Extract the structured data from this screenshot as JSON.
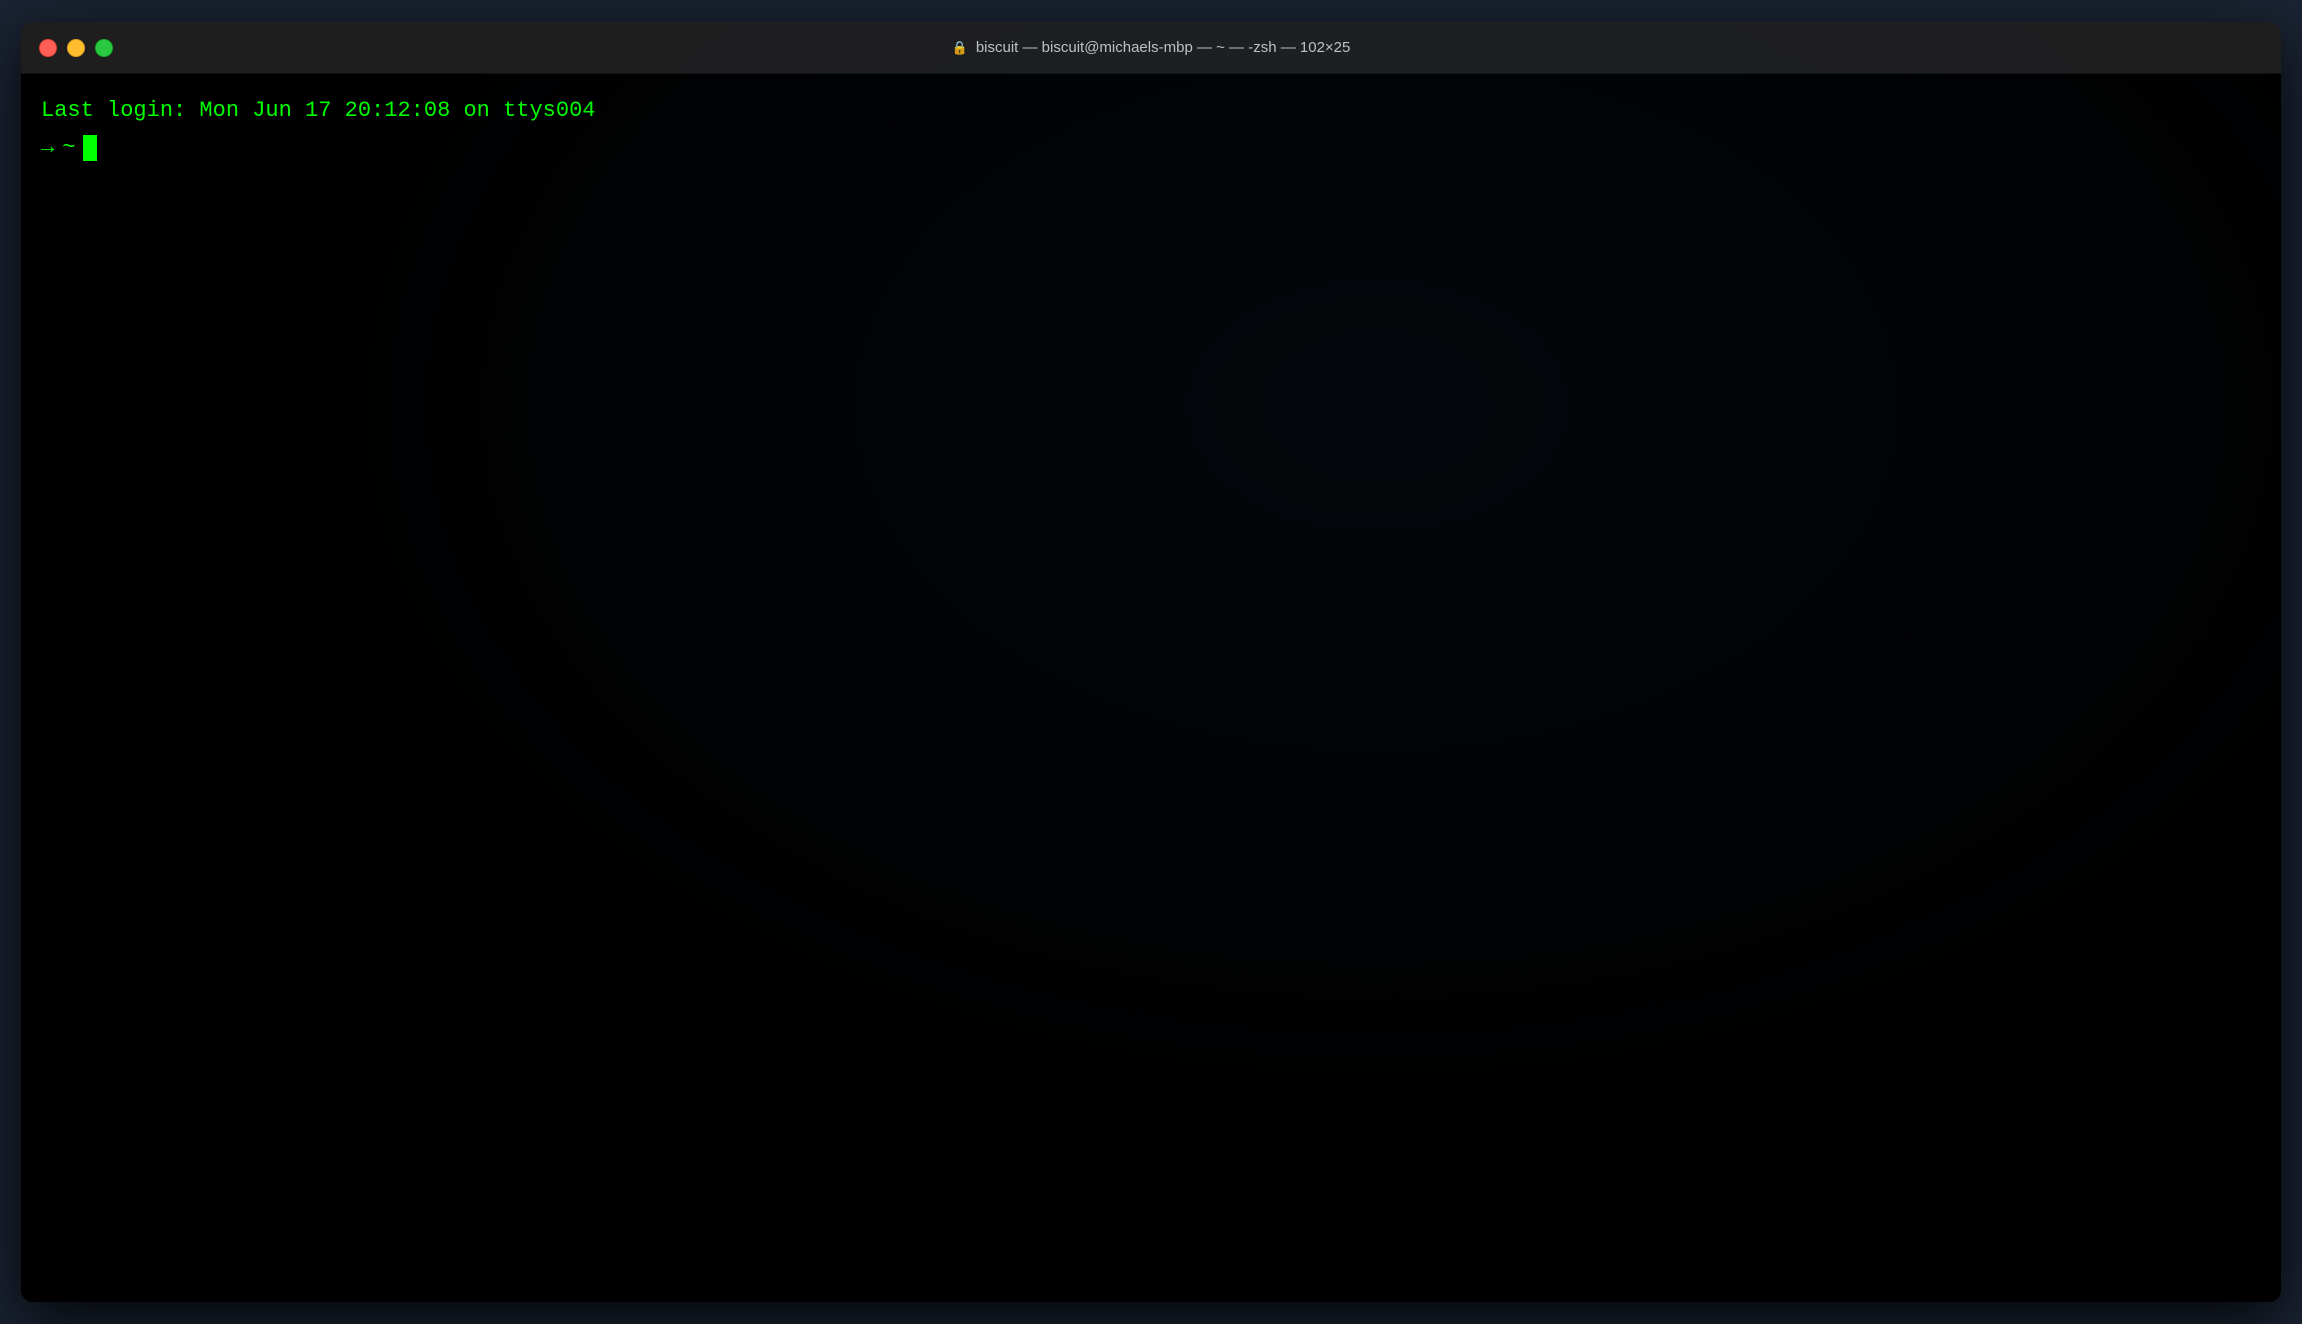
{
  "window": {
    "title": "biscuit — biscuit@michaels-mbp — ~ — -zsh — 102×25",
    "lock_icon": "🔒"
  },
  "traffic_lights": {
    "close_label": "close",
    "minimize_label": "minimize",
    "maximize_label": "maximize"
  },
  "terminal": {
    "last_login_line": "Last login: Mon Jun 17 20:12:08 on ttys004",
    "prompt_arrow": "→",
    "prompt_tilde": "~"
  }
}
